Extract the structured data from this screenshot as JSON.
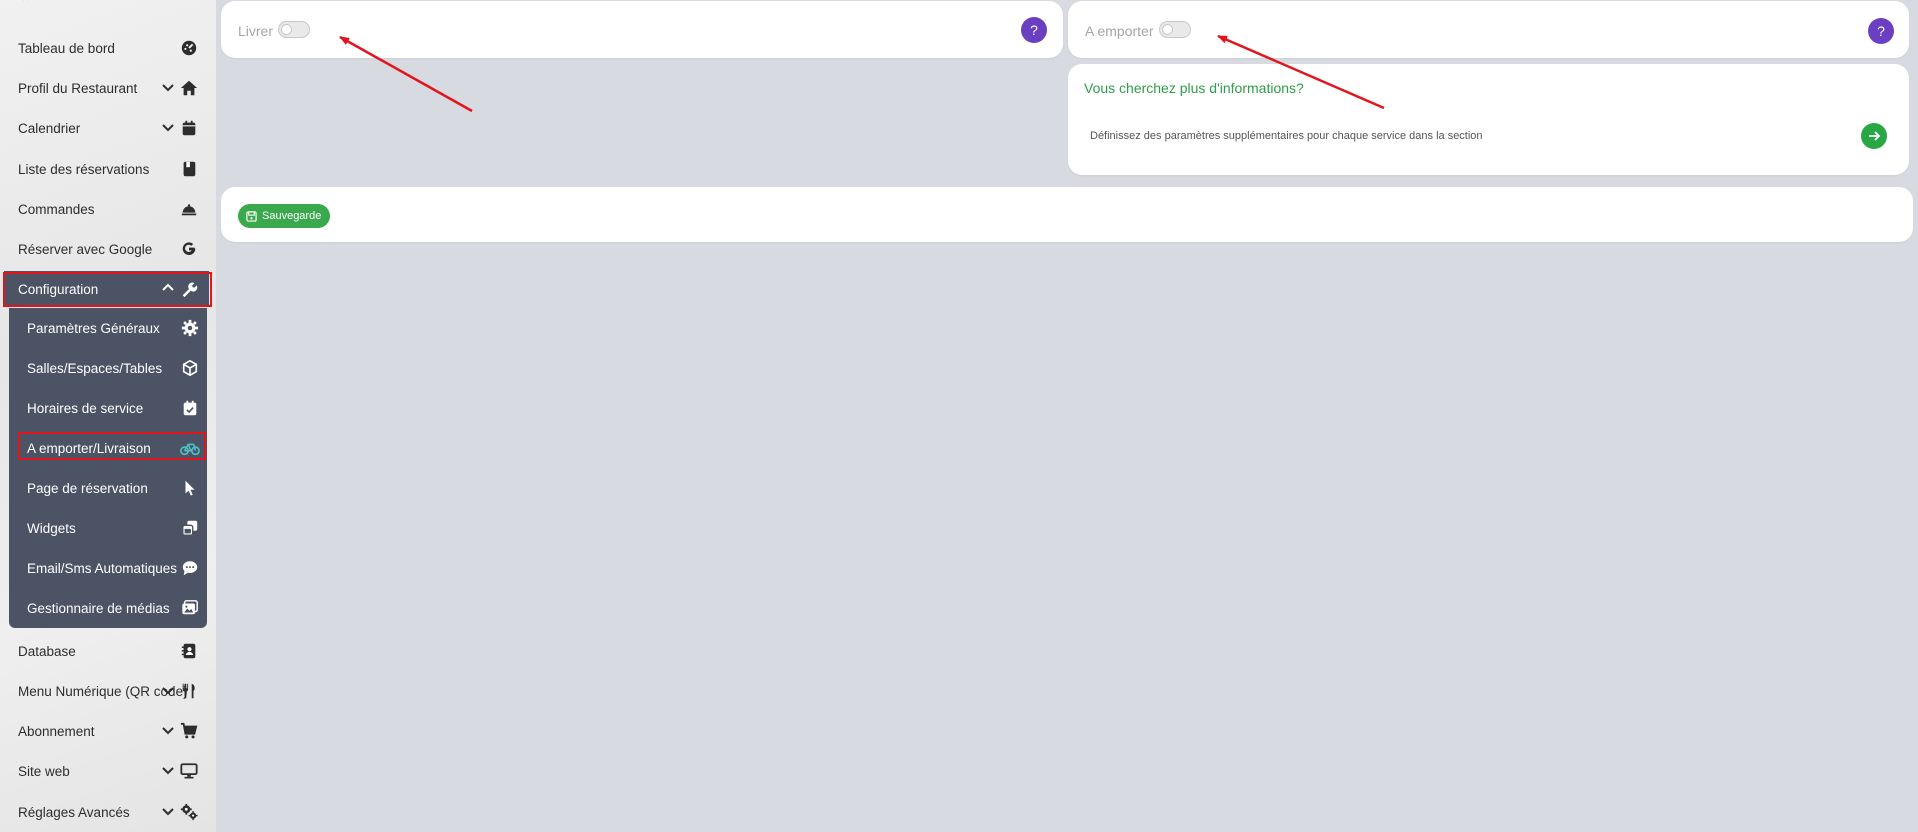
{
  "sidebar": {
    "items": [
      {
        "label": "Tableau de bord",
        "icon": "dashboard-icon"
      },
      {
        "label": "Profil du Restaurant",
        "icon": "home-icon",
        "chevron": "down"
      },
      {
        "label": "Calendrier",
        "icon": "calendar-icon",
        "chevron": "down"
      },
      {
        "label": "Liste des réservations",
        "icon": "book-icon"
      },
      {
        "label": "Commandes",
        "icon": "bell-icon"
      },
      {
        "label": "Réserver avec Google",
        "icon": "google-icon"
      },
      {
        "label": "Configuration",
        "icon": "wrench-icon",
        "chevron": "up",
        "active": true
      },
      {
        "label": "Database",
        "icon": "contacts-icon"
      },
      {
        "label": "Menu Numérique (QR code)",
        "icon": "utensils-icon",
        "chevron": "down"
      },
      {
        "label": "Abonnement",
        "icon": "cart-icon",
        "chevron": "down"
      },
      {
        "label": "Site web",
        "icon": "monitor-icon",
        "chevron": "down"
      },
      {
        "label": "Réglages Avancés",
        "icon": "gears-icon",
        "chevron": "down"
      }
    ],
    "submenu": [
      {
        "label": "Paramètres Généraux",
        "icon": "gear-icon"
      },
      {
        "label": "Salles/Espaces/Tables",
        "icon": "cube-icon"
      },
      {
        "label": "Horaires de service",
        "icon": "calendar-check-icon"
      },
      {
        "label": "A emporter/Livraison",
        "icon": "bicycle-icon",
        "highlighted": true
      },
      {
        "label": "Page de réservation",
        "icon": "cursor-icon"
      },
      {
        "label": "Widgets",
        "icon": "windows-icon"
      },
      {
        "label": "Email/Sms Automatiques",
        "icon": "chat-icon"
      },
      {
        "label": "Gestionnaire de médias",
        "icon": "image-icon"
      }
    ]
  },
  "delivery": {
    "label": "Livrer",
    "enabled": false,
    "help": "?"
  },
  "takeaway": {
    "label": "A emporter",
    "enabled": false,
    "help": "?"
  },
  "info": {
    "title": "Vous cherchez plus d'informations?",
    "text": "Définissez des paramètres supplémentaires pour chaque service dans la section"
  },
  "save_label": "Sauvegarde",
  "colors": {
    "sidebar_active": "#4b5365",
    "help_purple": "#6a3fc1",
    "success_green": "#28a745",
    "highlight_red": "#e3141c",
    "accent_teal": "#4fc3c8"
  }
}
